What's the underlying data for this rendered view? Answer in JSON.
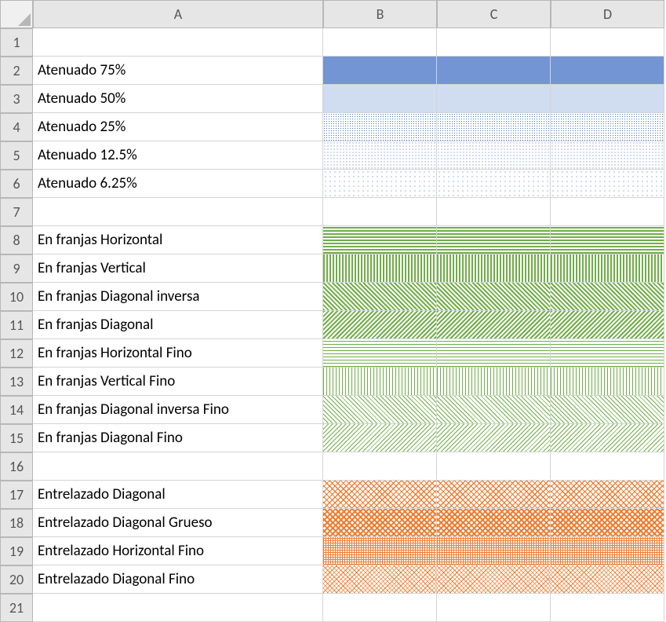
{
  "columns": [
    "A",
    "B",
    "C",
    "D"
  ],
  "rows": [
    {
      "n": 1,
      "label": "",
      "pattern": ""
    },
    {
      "n": 2,
      "label": "Atenuado 75%",
      "pattern": "p-att75"
    },
    {
      "n": 3,
      "label": "Atenuado 50%",
      "pattern": "p-att50"
    },
    {
      "n": 4,
      "label": "Atenuado 25%",
      "pattern": "p-att25"
    },
    {
      "n": 5,
      "label": "Atenuado 12.5%",
      "pattern": "p-att12"
    },
    {
      "n": 6,
      "label": "Atenuado 6.25%",
      "pattern": "p-att6"
    },
    {
      "n": 7,
      "label": "",
      "pattern": ""
    },
    {
      "n": 8,
      "label": "En franjas Horizontal",
      "pattern": "p-hstripe"
    },
    {
      "n": 9,
      "label": "En franjas Vertical",
      "pattern": "p-vstripe"
    },
    {
      "n": 10,
      "label": "En franjas Diagonal inversa",
      "pattern": "p-dstripe-r"
    },
    {
      "n": 11,
      "label": "En franjas Diagonal",
      "pattern": "p-dstripe"
    },
    {
      "n": 12,
      "label": "En franjas Horizontal Fino",
      "pattern": "p-hstripe-f"
    },
    {
      "n": 13,
      "label": "En franjas Vertical Fino",
      "pattern": "p-vstripe-f"
    },
    {
      "n": 14,
      "label": "En franjas Diagonal inversa Fino",
      "pattern": "p-dstripe-rf"
    },
    {
      "n": 15,
      "label": "En franjas Diagonal Fino",
      "pattern": "p-dstripe-f"
    },
    {
      "n": 16,
      "label": "",
      "pattern": ""
    },
    {
      "n": 17,
      "label": "Entrelazado Diagonal",
      "pattern": "p-xhatch-d"
    },
    {
      "n": 18,
      "label": "Entrelazado Diagonal Grueso",
      "pattern": "p-xhatch-dg"
    },
    {
      "n": 19,
      "label": "Entrelazado Horizontal Fino",
      "pattern": "p-xhatch-hf"
    },
    {
      "n": 20,
      "label": "Entrelazado Diagonal Fino",
      "pattern": "p-xhatch-df"
    },
    {
      "n": 21,
      "label": "",
      "pattern": ""
    }
  ],
  "colors": {
    "blue": "#4472C4",
    "green": "#70AD47",
    "orange": "#ED7D31"
  }
}
